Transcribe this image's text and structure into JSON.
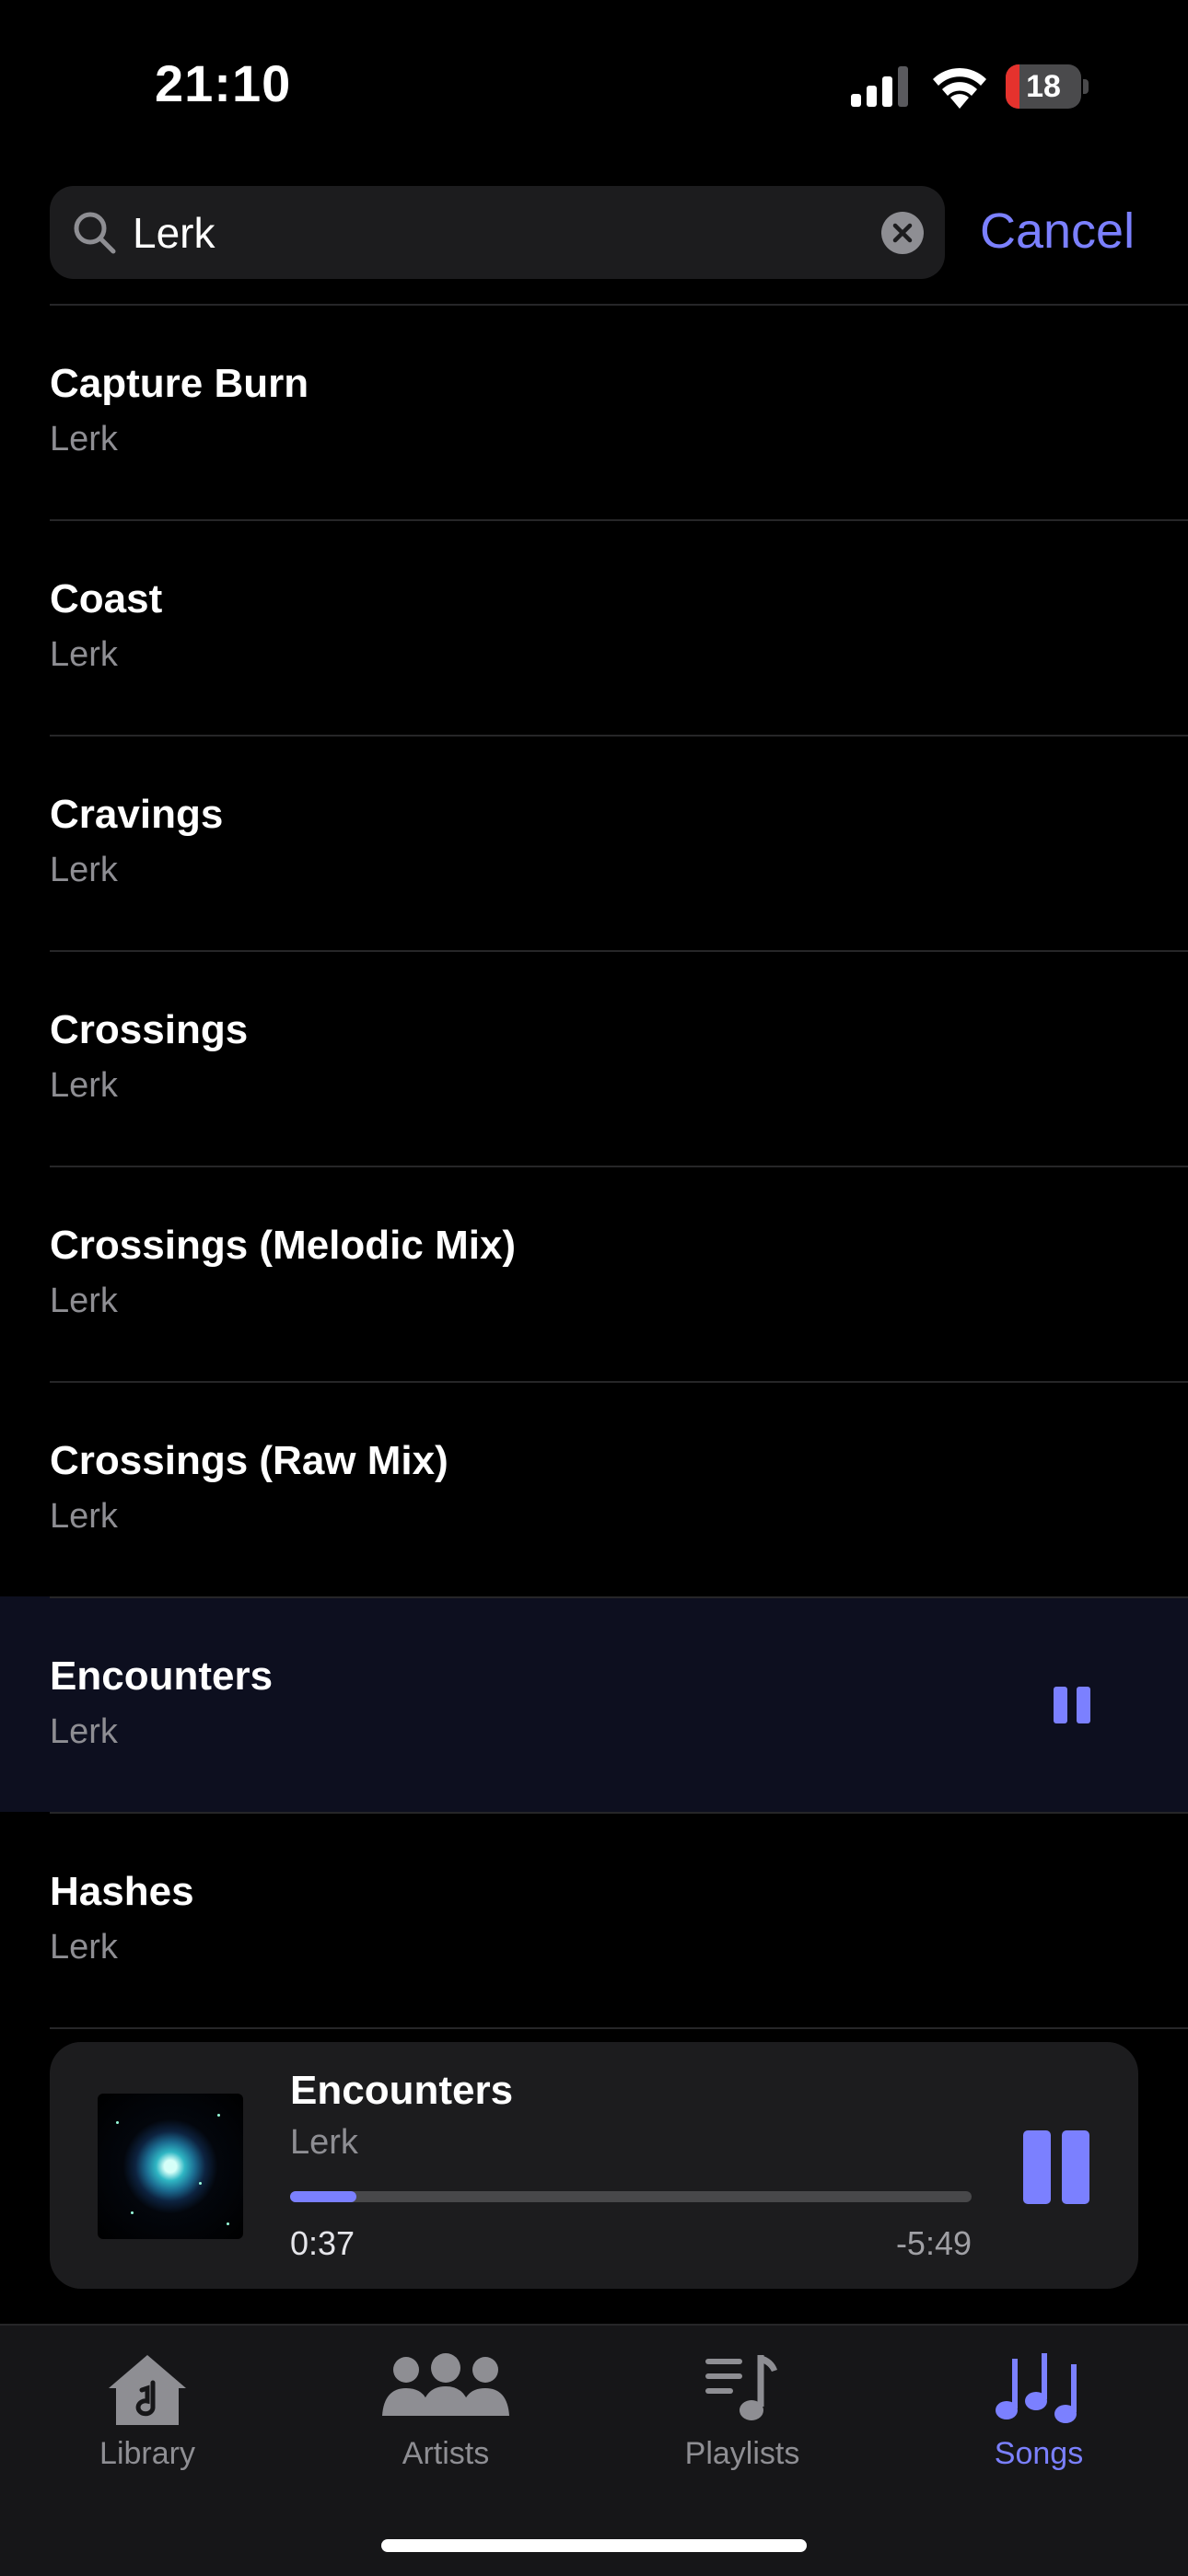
{
  "status_bar": {
    "time": "21:10",
    "battery_level": "18",
    "battery_fraction": 0.18,
    "icons": [
      "cellular-signal-icon",
      "wifi-icon",
      "battery-icon"
    ]
  },
  "search": {
    "value": "Lerk",
    "cancel_label": "Cancel"
  },
  "songs": [
    {
      "title": "Capture Burn",
      "artist": "Lerk"
    },
    {
      "title": "Coast",
      "artist": "Lerk"
    },
    {
      "title": "Cravings",
      "artist": "Lerk"
    },
    {
      "title": "Crossings",
      "artist": "Lerk"
    },
    {
      "title": "Crossings (Melodic Mix)",
      "artist": "Lerk"
    },
    {
      "title": "Crossings (Raw Mix)",
      "artist": "Lerk"
    },
    {
      "title": "Encounters",
      "artist": "Lerk",
      "playing": true
    },
    {
      "title": "Hashes",
      "artist": "Lerk"
    }
  ],
  "now_playing": {
    "title": "Encounters",
    "artist": "Lerk",
    "elapsed": "0:37",
    "remaining": "-5:49",
    "progress_fraction": 0.097
  },
  "tabs": [
    {
      "label": "Library",
      "icon": "house-music-icon"
    },
    {
      "label": "Artists",
      "icon": "people-icon"
    },
    {
      "label": "Playlists",
      "icon": "playlist-icon"
    },
    {
      "label": "Songs",
      "icon": "music-notes-icon",
      "selected": true
    }
  ],
  "colors": {
    "accent": "#7b80ff",
    "background": "#000000",
    "secondary_text": "#8e8e93",
    "battery_low": "#e5322d"
  }
}
